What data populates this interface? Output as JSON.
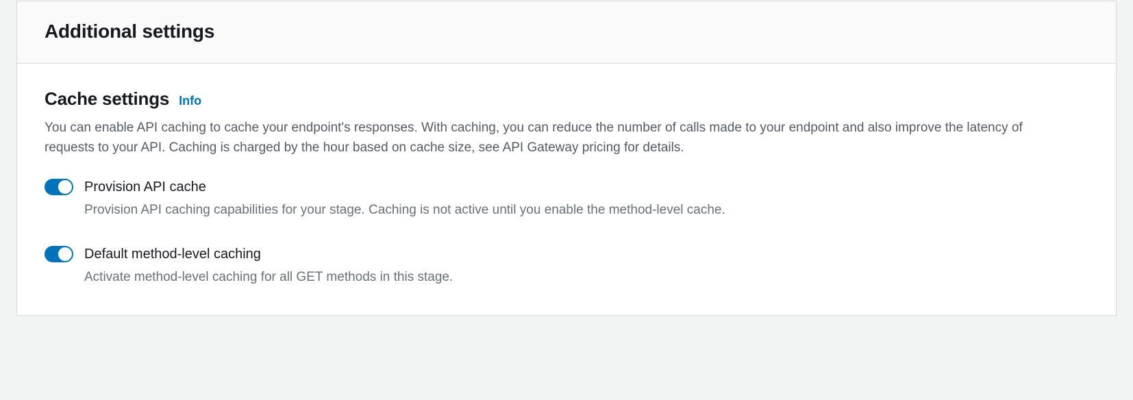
{
  "panel": {
    "title": "Additional settings"
  },
  "cache": {
    "heading": "Cache settings",
    "info_label": "Info",
    "description": "You can enable API caching to cache your endpoint's responses. With caching, you can reduce the number of calls made to your endpoint and also improve the latency of requests to your API. Caching is charged by the hour based on cache size, see API Gateway pricing for details.",
    "toggles": {
      "provision": {
        "label": "Provision API cache",
        "description": "Provision API caching capabilities for your stage. Caching is not active until you enable the method-level cache."
      },
      "default_method": {
        "label": "Default method-level caching",
        "description": "Activate method-level caching for all GET methods in this stage."
      }
    }
  }
}
